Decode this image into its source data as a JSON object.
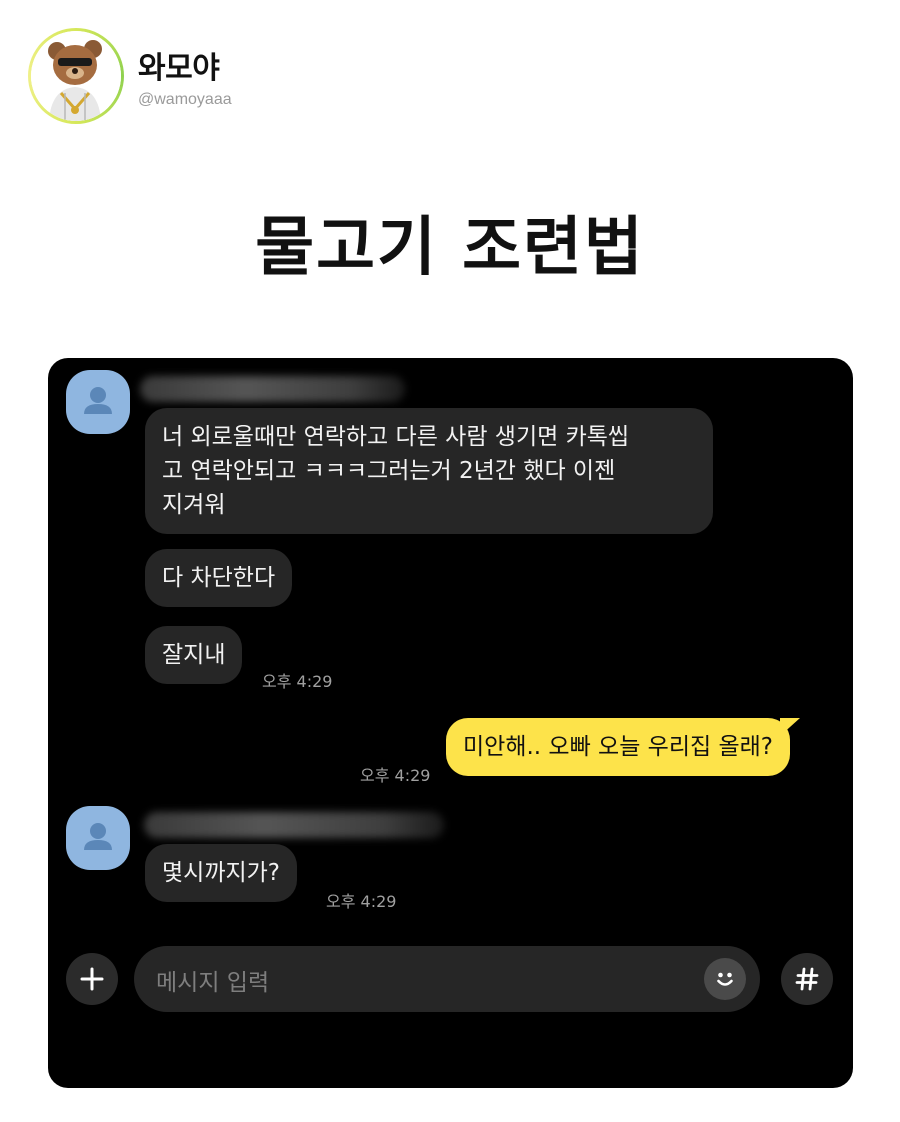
{
  "profile": {
    "name": "와모야",
    "handle": "@wamoyaaa"
  },
  "title": "물고기 조련법",
  "chat": {
    "messages": [
      {
        "from": "peer",
        "text_lines": [
          "너 외로울때만 연락하고 다른 사람 생기면 카톡씹",
          "고 연락안되고 ㅋㅋㅋ그러는거 2년간 했다 이젠",
          "지겨워"
        ]
      },
      {
        "from": "peer",
        "text": "다 차단한다"
      },
      {
        "from": "peer",
        "text": "잘지내",
        "time": "오후 4:29"
      },
      {
        "from": "me",
        "text": "미안해.. 오빠 오늘 우리집 올래?",
        "time": "오후 4:29"
      },
      {
        "from": "peer",
        "text": "몇시까지가?",
        "time": "오후 4:29"
      }
    ],
    "composer": {
      "placeholder": "메시지 입력"
    }
  },
  "icons": {
    "plus": "plus-icon",
    "emoji": "smiley-icon",
    "hashtag": "hashtag-icon",
    "peer_avatar": "person-icon"
  },
  "colors": {
    "chat_bg": "#000000",
    "peer_bubble": "#262626",
    "my_bubble": "#fde34a",
    "peer_avatar": "#8fb6e0"
  }
}
